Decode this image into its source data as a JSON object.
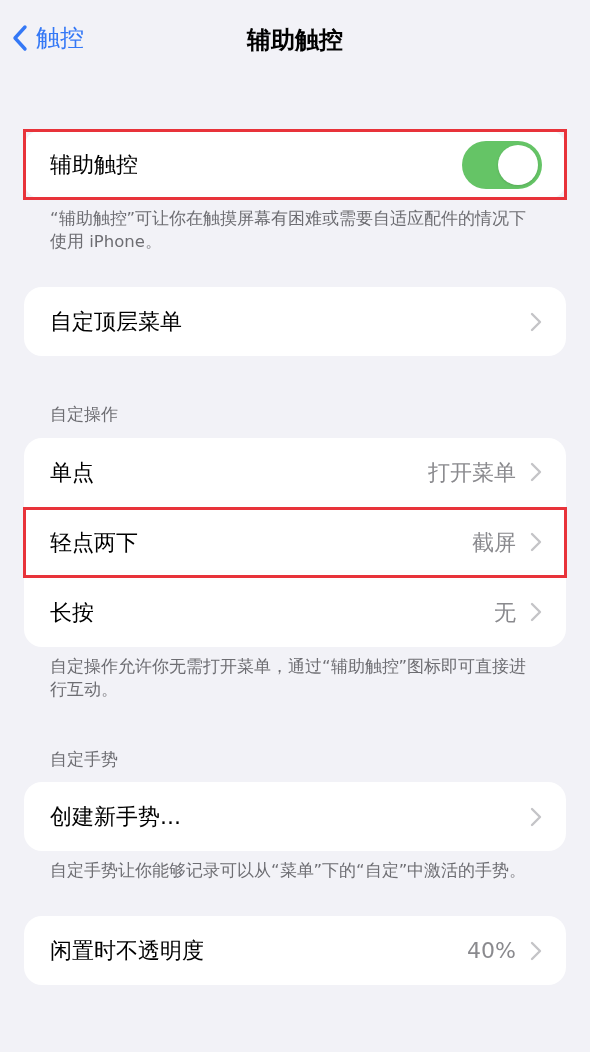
{
  "nav": {
    "back": "触控",
    "title": "辅助触控"
  },
  "groups": [
    {
      "rows": [
        {
          "kind": "toggle",
          "label": "辅助触控",
          "on": true,
          "highlighted": true
        }
      ],
      "footer": "“辅助触控”可让你在触摸屏幕有困难或需要自适应配件的情况下使用 iPhone。"
    },
    {
      "rows": [
        {
          "kind": "link",
          "label": "自定顶层菜单",
          "highlighted": false
        }
      ]
    },
    {
      "header": "自定操作",
      "rows": [
        {
          "kind": "link",
          "label": "单点",
          "value": "打开菜单",
          "highlighted": false
        },
        {
          "kind": "link",
          "label": "轻点两下",
          "value": "截屏",
          "highlighted": true
        },
        {
          "kind": "link",
          "label": "长按",
          "value": "无",
          "highlighted": false
        }
      ],
      "footer": "自定操作允许你无需打开菜单，通过“辅助触控”图标即可直接进行互动。"
    },
    {
      "header": "自定手势",
      "rows": [
        {
          "kind": "link",
          "label": "创建新手势...",
          "highlighted": false
        }
      ],
      "footer": "自定手势让你能够记录可以从“菜单”下的“自定”中激活的手势。"
    },
    {
      "rows": [
        {
          "kind": "link",
          "label": "闲置时不透明度",
          "value": "40%",
          "highlighted": false
        }
      ]
    }
  ]
}
